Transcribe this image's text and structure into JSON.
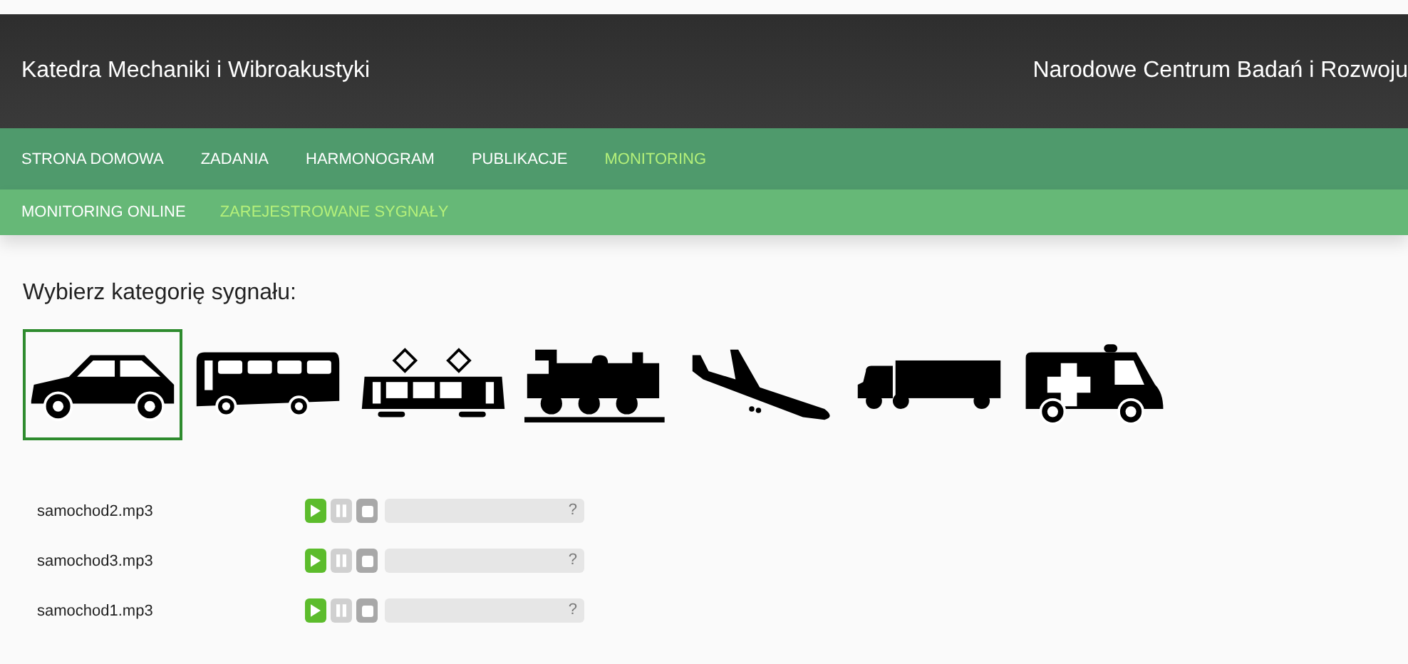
{
  "header": {
    "title": "Katedra Mechaniki i Wibroakustyki",
    "partner": "Narodowe Centrum Badań i Rozwoju"
  },
  "nav": [
    {
      "label": "STRONA DOMOWA",
      "selected": false
    },
    {
      "label": "ZADANIA",
      "selected": false
    },
    {
      "label": "HARMONOGRAM",
      "selected": false
    },
    {
      "label": "PUBLIKACJE",
      "selected": false
    },
    {
      "label": "MONITORING",
      "selected": true
    }
  ],
  "subnav": [
    {
      "label": "MONITORING ONLINE",
      "selected": false
    },
    {
      "label": "ZAREJESTROWANE SYGNAŁY",
      "selected": true
    }
  ],
  "heading": "Wybierz kategorię sygnału:",
  "categories": [
    {
      "kind": "car",
      "selected": true
    },
    {
      "kind": "bus",
      "selected": false
    },
    {
      "kind": "tram",
      "selected": false
    },
    {
      "kind": "train",
      "selected": false
    },
    {
      "kind": "plane",
      "selected": false
    },
    {
      "kind": "truck",
      "selected": false
    },
    {
      "kind": "ambulance",
      "selected": false
    }
  ],
  "tracks": [
    {
      "name": "samochod2.mp3",
      "time": "?"
    },
    {
      "name": "samochod3.mp3",
      "time": "?"
    },
    {
      "name": "samochod1.mp3",
      "time": "?"
    }
  ]
}
